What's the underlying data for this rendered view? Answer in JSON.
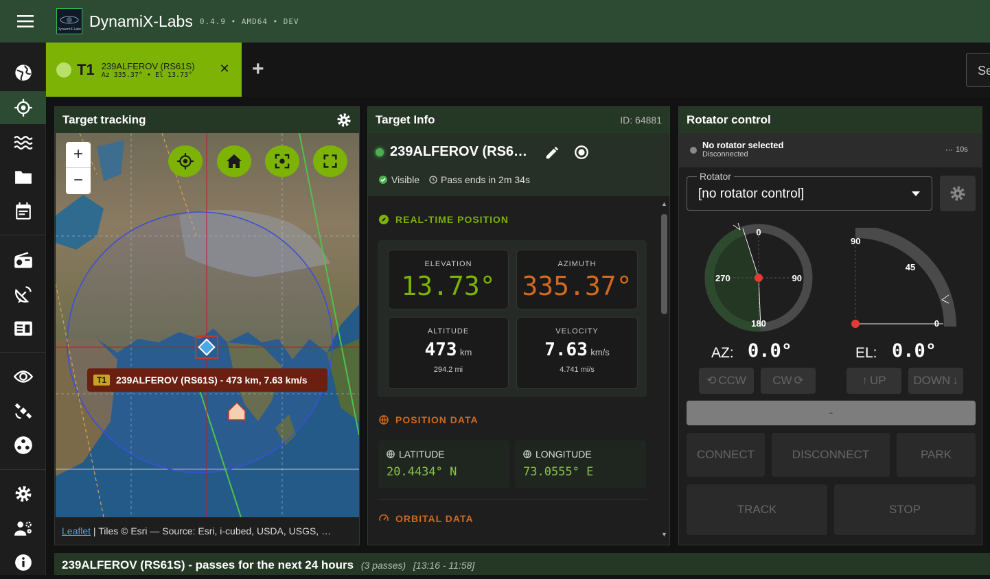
{
  "app": {
    "title": "DynamiX-Labs",
    "version": "0.4.9 • AMD64 • DEV",
    "logo_text": "DynamiX-Labs"
  },
  "sidebar": {
    "items": [
      {
        "name": "globe-icon"
      },
      {
        "name": "target-icon",
        "active": true
      },
      {
        "name": "waves-icon"
      },
      {
        "name": "folder-icon"
      },
      {
        "name": "calendar-icon"
      },
      {
        "name": "radio-icon"
      },
      {
        "name": "satellite-dish-icon"
      },
      {
        "name": "id-card-icon"
      },
      {
        "name": "eye-icon"
      },
      {
        "name": "satellite-icon"
      },
      {
        "name": "hub-icon"
      },
      {
        "name": "settings-icon"
      },
      {
        "name": "engineer-icon"
      },
      {
        "name": "info-icon"
      }
    ]
  },
  "tabs": [
    {
      "tag": "T1",
      "name": "239ALFEROV (RS61S)",
      "sub": "Az 335.37° • El 13.73°"
    }
  ],
  "search": {
    "text": "Se"
  },
  "map_panel": {
    "title": "Target tracking",
    "zoom_in": "+",
    "zoom_out": "−",
    "tooltip_tag": "T1",
    "tooltip_text": "239ALFEROV (RS61S) - 473 km, 7.63 km/s",
    "attribution_link": "Leaflet",
    "attribution_text": " | Tiles © Esri — Source: Esri, i-cubed, USDA, USGS, …"
  },
  "target_info": {
    "title": "Target Info",
    "id": "ID: 64881",
    "name": "239ALFEROV (RS6…",
    "visible": "Visible",
    "pass_ends": "Pass ends in 2m 34s",
    "realtime_title": "REAL-TIME POSITION",
    "elevation_label": "ELEVATION",
    "elevation": "13.73°",
    "azimuth_label": "AZIMUTH",
    "azimuth": "335.37°",
    "altitude_label": "ALTITUDE",
    "altitude": "473",
    "altitude_unit": "km",
    "altitude_mi": "294.2 mi",
    "velocity_label": "VELOCITY",
    "velocity": "7.63",
    "velocity_unit": "km/s",
    "velocity_mi": "4.741 mi/s",
    "position_title": "POSITION DATA",
    "latitude_label": "LATITUDE",
    "latitude": "20.4434° N",
    "longitude_label": "LONGITUDE",
    "longitude": "73.0555° E",
    "orbital_title": "ORBITAL DATA",
    "colors": {
      "green": "#7cb305",
      "orange": "#d2691e"
    }
  },
  "rotator": {
    "title": "Rotator control",
    "status_title": "No rotator selected",
    "status_sub": "Disconnected",
    "interval": "10s",
    "select_label": "Rotator",
    "select_value": "[no rotator control]",
    "az_labels": {
      "n": "0",
      "e": "90",
      "s": "180",
      "w": "270"
    },
    "el_labels": {
      "top": "90",
      "mid": "45",
      "bottom": "0"
    },
    "az_label": "AZ:",
    "az_value": "0.0°",
    "el_label": "EL:",
    "el_value": "0.0°",
    "ccw": "CCW",
    "cw": "CW",
    "up": "UP",
    "down": "DOWN",
    "status_bar": "-",
    "connect": "CONNECT",
    "disconnect": "DISCONNECT",
    "park": "PARK",
    "track": "TRACK",
    "stop": "STOP"
  },
  "passes": {
    "title": "239ALFEROV (RS61S) - passes for the next 24 hours",
    "count": "(3 passes)",
    "range": "[13:16 - 11:58]"
  }
}
